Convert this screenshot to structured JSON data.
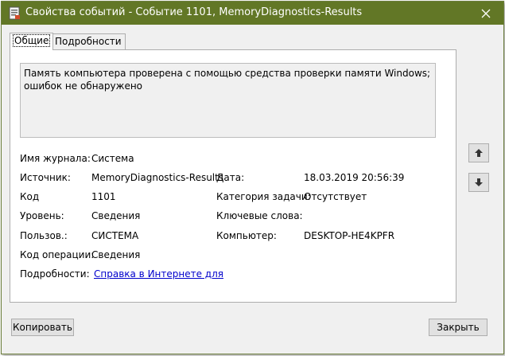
{
  "window": {
    "title": "Свойства событий - Событие 1101, MemoryDiagnostics-Results"
  },
  "tabs": [
    {
      "label": "Общие",
      "active": true
    },
    {
      "label": "Подробности",
      "active": false
    }
  ],
  "general": {
    "description": "Память компьютера проверена с помощью средства проверки памяти Windows; ошибок не обнаружено",
    "fields": {
      "log_name": {
        "label": "Имя журнала:",
        "value": "Система"
      },
      "source": {
        "label": "Источник:",
        "value": "MemoryDiagnostics-Results"
      },
      "date": {
        "label": "Дата:",
        "value": "18.03.2019 20:56:39"
      },
      "event_id": {
        "label": "Код",
        "value": "1101"
      },
      "task_category": {
        "label": "Категория задачи:",
        "value": "Отсутствует"
      },
      "level": {
        "label": "Уровень:",
        "value": "Сведения"
      },
      "keywords": {
        "label": "Ключевые слова:",
        "value": ""
      },
      "user": {
        "label": "Пользов.:",
        "value": "СИСТЕМА"
      },
      "computer": {
        "label": "Компьютер:",
        "value": "DESKTOP-HE4KPFR"
      },
      "opcode": {
        "label": "Код операции:",
        "value": "Сведения"
      },
      "more_info": {
        "label": "Подробности:",
        "link": "Справка в Интернете для"
      }
    }
  },
  "buttons": {
    "copy": "Копировать",
    "close": "Закрыть"
  },
  "colors": {
    "titlebar": "#627726",
    "link": "#0000cc"
  },
  "icons": {
    "title": "event-viewer-icon",
    "close": "close-icon",
    "up": "arrow-up-icon",
    "down": "arrow-down-icon"
  }
}
